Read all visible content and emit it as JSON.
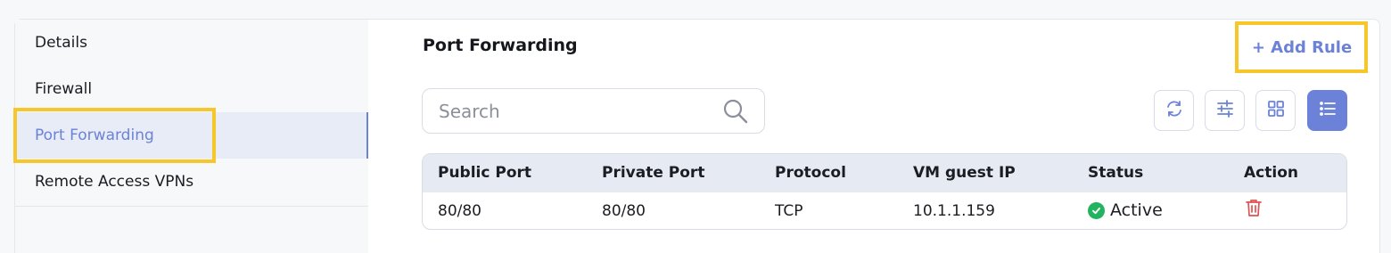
{
  "sidebar": {
    "items": [
      {
        "label": "Details"
      },
      {
        "label": "Firewall"
      },
      {
        "label": "Port Forwarding"
      },
      {
        "label": "Remote Access VPNs"
      }
    ],
    "active_index": 2
  },
  "main": {
    "title": "Port Forwarding",
    "add_button_label": "+ Add Rule",
    "search": {
      "placeholder": "Search",
      "value": ""
    },
    "toolbar": {
      "icons": [
        "refresh-icon",
        "filter-sliders-icon",
        "grid-view-icon",
        "list-view-icon"
      ],
      "active": "list-view-icon"
    },
    "table": {
      "columns": [
        "Public Port",
        "Private Port",
        "Protocol",
        "VM guest IP",
        "Status",
        "Action"
      ],
      "rows": [
        {
          "public_port": "80/80",
          "private_port": "80/80",
          "protocol": "TCP",
          "vm_guest_ip": "10.1.1.159",
          "status": "Active",
          "action_icon": "trash-icon"
        }
      ]
    }
  },
  "colors": {
    "accent": "#6b82d8",
    "highlight": "#f6c62b",
    "status_active": "#22b35e",
    "delete": "#e05252"
  }
}
